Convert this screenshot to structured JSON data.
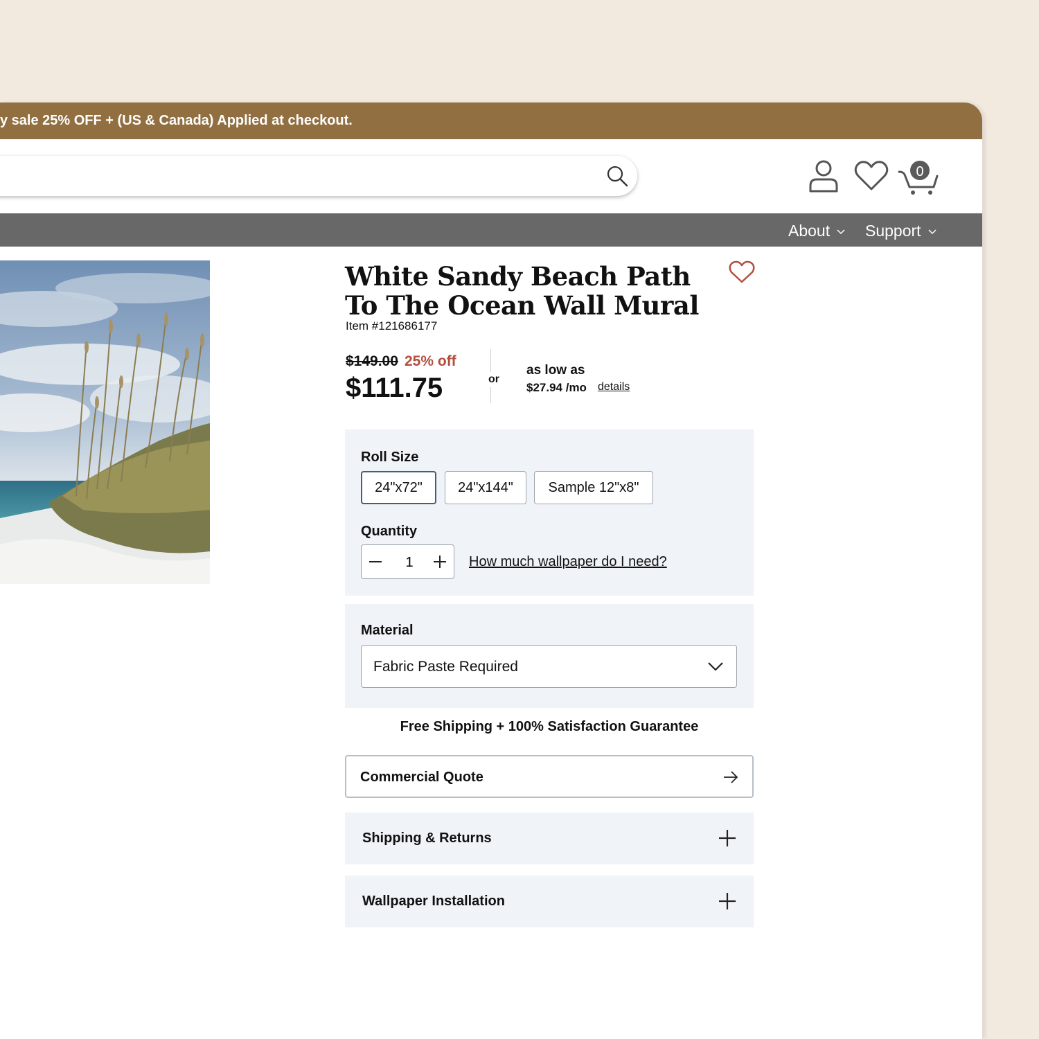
{
  "promo": {
    "text": "y sale 25% OFF + (US & Canada) Applied at checkout."
  },
  "header": {
    "cart_count": "0"
  },
  "nav": {
    "items": [
      {
        "label": "About"
      },
      {
        "label": "Support"
      }
    ]
  },
  "product": {
    "title": "White Sandy Beach Path To The Ocean Wall Mural",
    "item_number": "Item #121686177",
    "original_price": "$149.00",
    "discount": "25% off",
    "price": "$111.75",
    "or_label": "or",
    "financing_label": "as low as",
    "monthly": "$27.94 /mo",
    "details_link": "details"
  },
  "options": {
    "roll_size_label": "Roll Size",
    "sizes": [
      {
        "label": "24\"x72\"",
        "selected": true
      },
      {
        "label": "24\"x144\""
      },
      {
        "label": "Sample 12\"x8\""
      }
    ],
    "quantity_label": "Quantity",
    "quantity_value": "1",
    "help_link": "How much wallpaper do I need?"
  },
  "material": {
    "label": "Material",
    "selected": "Fabric Paste Required"
  },
  "guarantee": "Free Shipping + 100% Satisfaction Guarantee",
  "commercial_quote": "Commercial Quote",
  "accordions": [
    {
      "label": "Shipping & Returns"
    },
    {
      "label": "Wallpaper Installation"
    }
  ],
  "colors": {
    "promo_bar": "#916f41",
    "nav_bar": "#686868",
    "accent_red": "#b34e3e",
    "panel_bg": "#f0f4f8",
    "page_bg": "#f2e9df"
  },
  "icons": [
    "search-icon",
    "account-icon",
    "heart-icon",
    "cart-icon",
    "chevron-down-icon",
    "minus-icon",
    "plus-icon",
    "arrow-right-icon"
  ]
}
